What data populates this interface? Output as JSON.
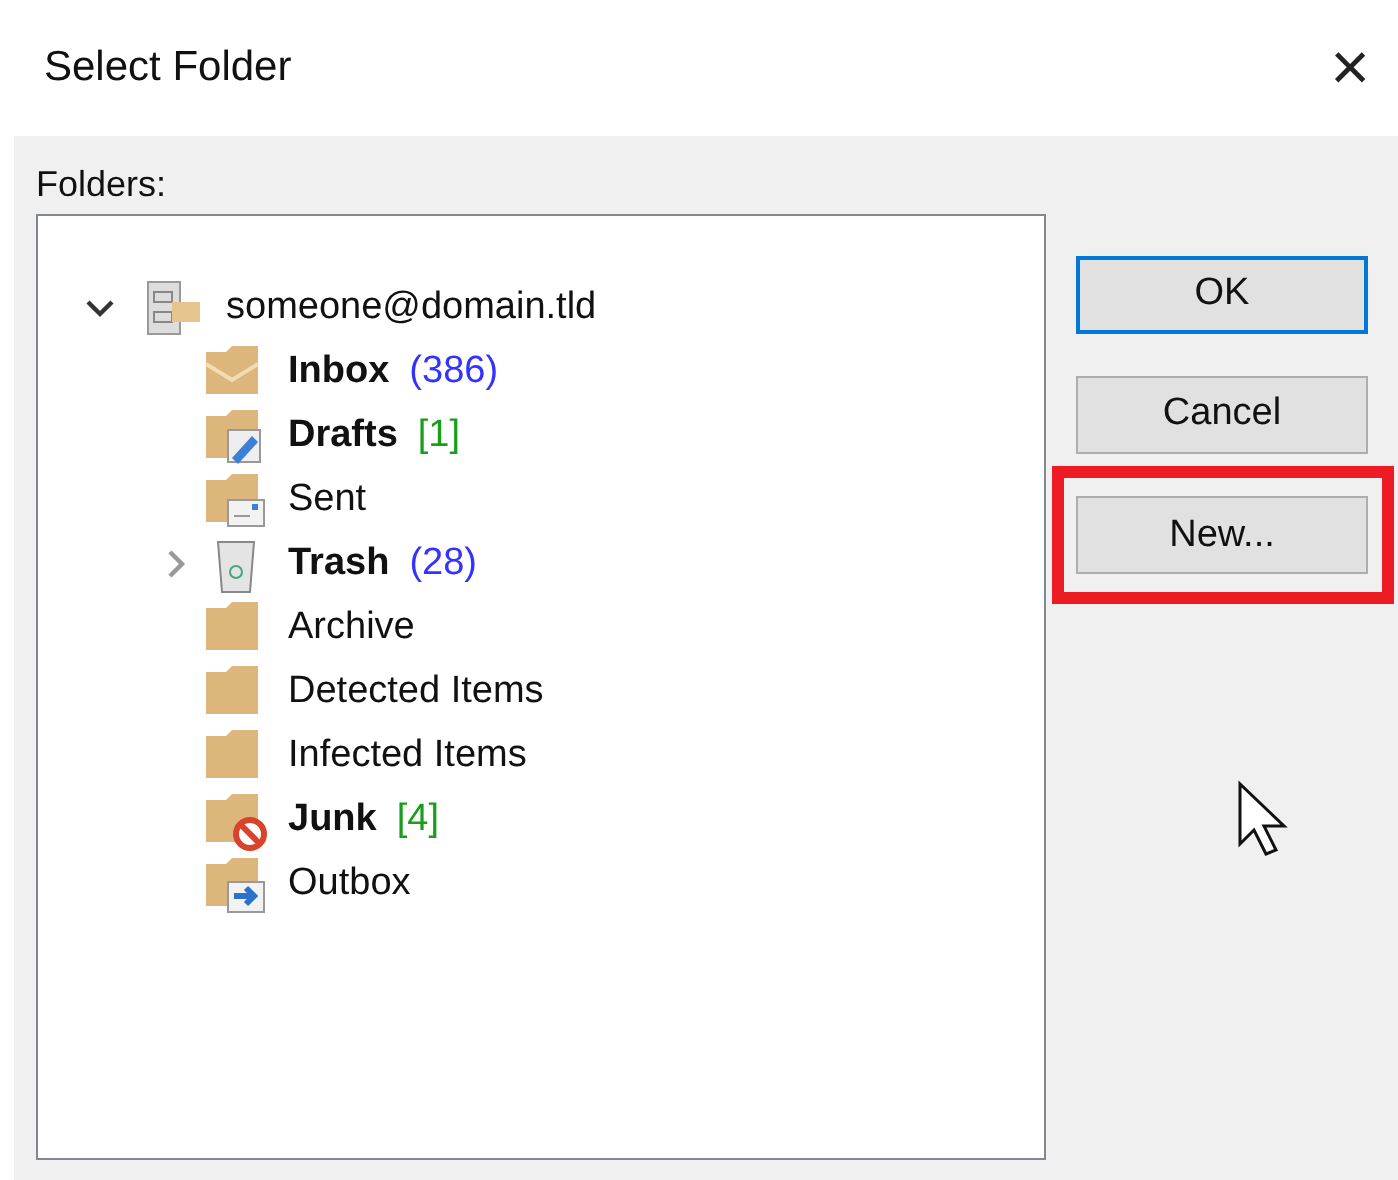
{
  "window": {
    "title": "Select Folder",
    "close": "×"
  },
  "folders_label": "Folders:",
  "tree": [
    {
      "name": "someone@domain.tld",
      "kind": "account",
      "bold": false,
      "expanded": true,
      "children": [
        {
          "name": "Inbox",
          "kind": "inbox",
          "bold": true,
          "count": "(386)",
          "color": "#3333ff"
        },
        {
          "name": "Drafts",
          "kind": "drafts",
          "bold": true,
          "count": "[1]",
          "color": "#1a9e1a"
        },
        {
          "name": "Sent",
          "kind": "sent",
          "bold": false
        },
        {
          "name": "Trash",
          "kind": "trash",
          "bold": true,
          "count": "(28)",
          "color": "#3333ff",
          "expandable": true,
          "expanded": false
        },
        {
          "name": "Archive",
          "kind": "folder",
          "bold": false
        },
        {
          "name": "Detected Items",
          "kind": "folder",
          "bold": false
        },
        {
          "name": "Infected Items",
          "kind": "folder",
          "bold": false
        },
        {
          "name": "Junk",
          "kind": "junk",
          "bold": true,
          "count": "[4]",
          "color": "#1a9e1a"
        },
        {
          "name": "Outbox",
          "kind": "outbox",
          "bold": false
        }
      ]
    }
  ],
  "buttons": [
    {
      "label": "OK",
      "default": true,
      "highlighted": false
    },
    {
      "label": "Cancel",
      "default": false,
      "highlighted": false
    },
    {
      "label": "New...",
      "default": false,
      "highlighted": true
    }
  ]
}
